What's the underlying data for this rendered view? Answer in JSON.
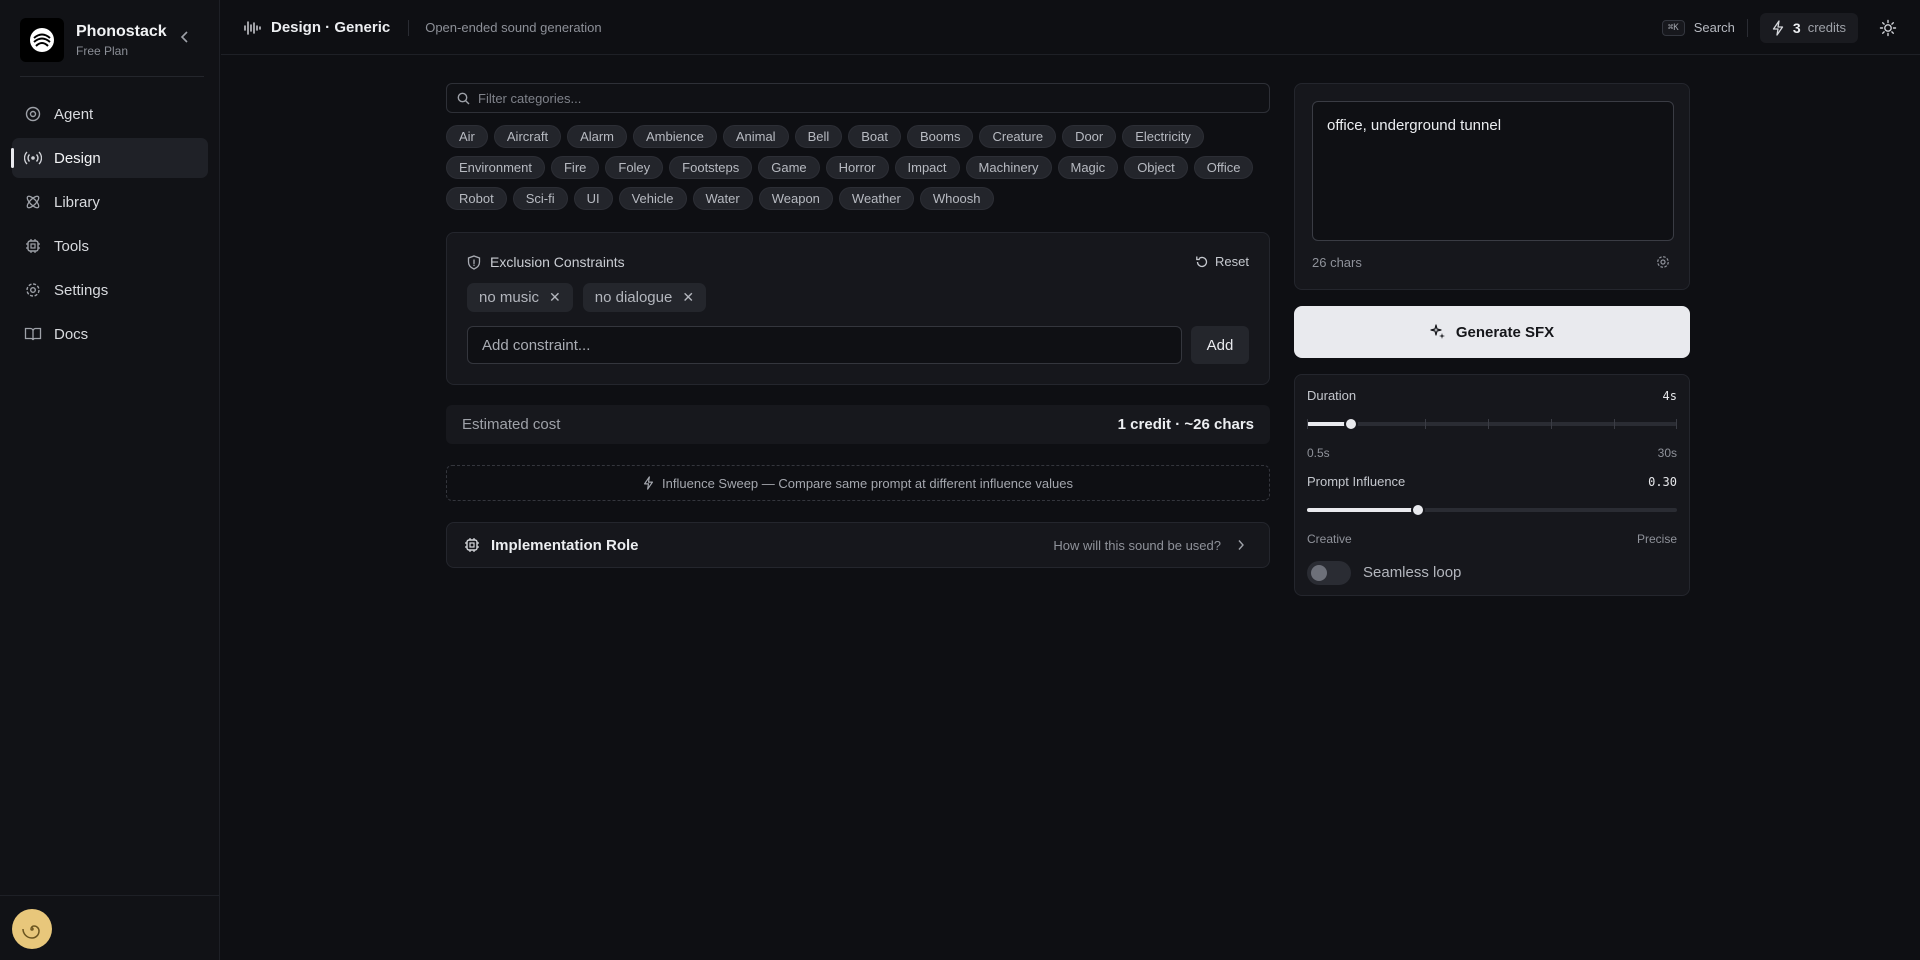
{
  "brand": {
    "name": "Phonostack",
    "plan": "Free Plan"
  },
  "nav": [
    {
      "label": "Agent",
      "icon": "agent-icon"
    },
    {
      "label": "Design",
      "icon": "broadcast-icon",
      "active": true
    },
    {
      "label": "Library",
      "icon": "atom-icon"
    },
    {
      "label": "Tools",
      "icon": "chip-icon"
    },
    {
      "label": "Settings",
      "icon": "gear-icon"
    },
    {
      "label": "Docs",
      "icon": "book-icon"
    }
  ],
  "header": {
    "title": "Design · Generic",
    "subtitle": "Open-ended sound generation",
    "shortcut": "⌘K",
    "search_label": "Search",
    "credits_count": "3",
    "credits_label": "credits"
  },
  "filter": {
    "placeholder": "Filter categories..."
  },
  "categories": [
    "Air",
    "Aircraft",
    "Alarm",
    "Ambience",
    "Animal",
    "Bell",
    "Boat",
    "Booms",
    "Creature",
    "Door",
    "Electricity",
    "Environment",
    "Fire",
    "Foley",
    "Footsteps",
    "Game",
    "Horror",
    "Impact",
    "Machinery",
    "Magic",
    "Object",
    "Office",
    "Robot",
    "Sci-fi",
    "UI",
    "Vehicle",
    "Water",
    "Weapon",
    "Weather",
    "Whoosh"
  ],
  "exclusions": {
    "title": "Exclusion Constraints",
    "reset_label": "Reset",
    "tags": [
      "no music",
      "no dialogue"
    ],
    "input_placeholder": "Add constraint...",
    "add_label": "Add"
  },
  "cost": {
    "label": "Estimated cost",
    "value": "1 credit · ~26 chars"
  },
  "sweep": {
    "label": "Influence Sweep — Compare same prompt at different influence values"
  },
  "implementation": {
    "title": "Implementation Role",
    "hint": "How will this sound be used?"
  },
  "prompt": {
    "value": "office, underground tunnel",
    "char_count": "26 chars"
  },
  "generate": {
    "label": "Generate SFX"
  },
  "duration": {
    "label": "Duration",
    "value": "4s",
    "min_label": "0.5s",
    "max_label": "30s",
    "fraction": 0.12
  },
  "influence": {
    "label": "Prompt Influence",
    "value": "0.30",
    "min_label": "Creative",
    "max_label": "Precise",
    "fraction": 0.3
  },
  "loop": {
    "label": "Seamless loop",
    "enabled": false
  },
  "colors": {
    "accent": "#e9eaee",
    "background": "#0e0f13",
    "card": "#16171c",
    "avatar": "#e8c77b"
  }
}
